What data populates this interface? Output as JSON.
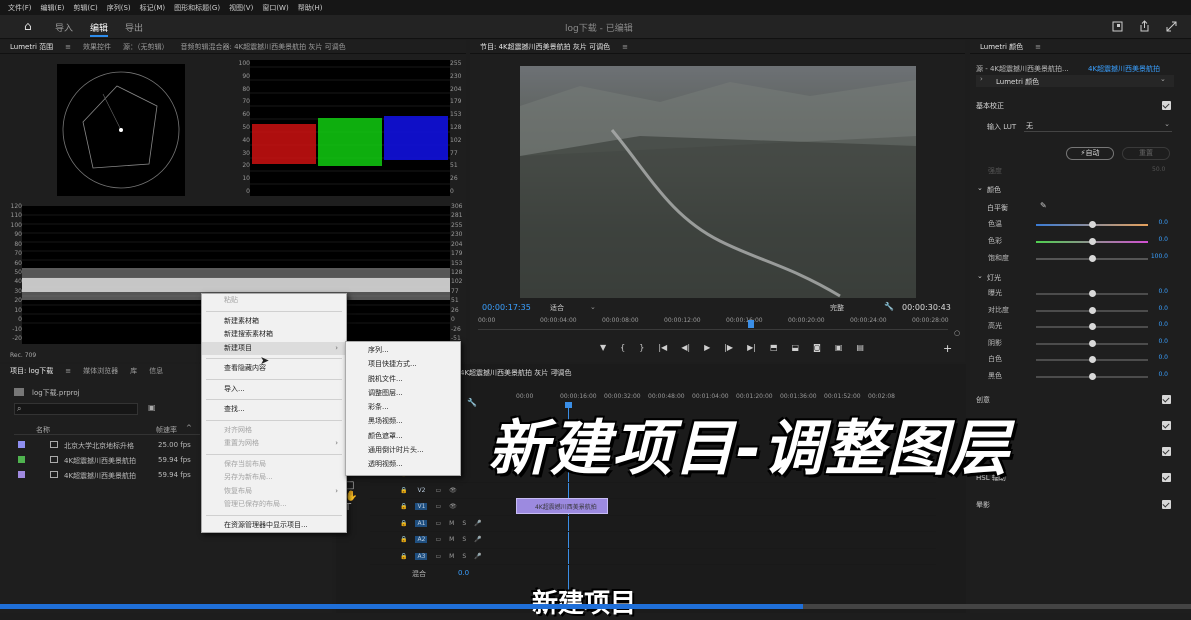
{
  "menubar": [
    "文件(F)",
    "编辑(E)",
    "剪辑(C)",
    "序列(S)",
    "标记(M)",
    "图形和标题(G)",
    "视图(V)",
    "窗口(W)",
    "帮助(H)"
  ],
  "appbar": {
    "home": "⌂",
    "tabs": [
      "导入",
      "编辑",
      "导出"
    ],
    "active": "编辑",
    "title": "log下载 - 已编辑"
  },
  "scopes": {
    "tabs": [
      "Lumetri 范围",
      "效果控件",
      "源：（无剪辑）",
      "音频剪辑混合器: 4K超震撼川西美景航拍 灰片 可调色"
    ],
    "parade_left": [
      "100",
      "90",
      "80",
      "70",
      "60",
      "50",
      "40",
      "30",
      "20",
      "10",
      "0"
    ],
    "parade_right": [
      "255",
      "230",
      "204",
      "179",
      "153",
      "128",
      "102",
      "77",
      "51",
      "26",
      "0"
    ],
    "wave_left": [
      "120",
      "110",
      "100",
      "90",
      "80",
      "70",
      "60",
      "50",
      "40",
      "30",
      "20",
      "10",
      "0",
      "-10",
      "-20"
    ],
    "wave_right": [
      "306",
      "281",
      "255",
      "230",
      "204",
      "179",
      "153",
      "128",
      "102",
      "77",
      "51",
      "26",
      "0",
      "-26",
      "-51"
    ],
    "rec": "Rec. 709"
  },
  "project": {
    "tabs": [
      "项目: log下载",
      "媒体浏览器",
      "库",
      "信息"
    ],
    "file": "log下载.prproj",
    "col_name": "名称",
    "col_rate": "帧速率",
    "items": [
      {
        "name": "北京大学北京地标升格",
        "rate": "25.00 fps",
        "color": "#8e8ef0"
      },
      {
        "name": "4K超震撼川西美景航拍",
        "rate": "59.94 fps",
        "color": "#4fb34f"
      },
      {
        "name": "4K超震撼川西美景航拍",
        "rate": "59.94 fps",
        "color": "#a08ae0"
      }
    ]
  },
  "program": {
    "title": "节目: 4K超震撼川西美景航拍 灰片 可调色",
    "timecode": "00:00:17:35",
    "fit": "适合",
    "full": "完整",
    "duration": "00:00:30:43",
    "ruler": [
      "00:00",
      "00:00:04:00",
      "00:00:08:00",
      "00:00:12:00",
      "00:00:16:00",
      "00:00:20:00",
      "00:00:24:00",
      "00:00:28:00"
    ]
  },
  "timeline": {
    "title": "4K超震撼川西美景航拍 灰片 可调色",
    "ruler": [
      "00:00",
      "00:00:16:00",
      "00:00:32:00",
      "00:00:48:00",
      "00:01:04:00",
      "00:01:20:00",
      "00:01:36:00",
      "00:01:52:00",
      "00:02:08"
    ],
    "tracks": [
      "V3",
      "V2",
      "V1",
      "A1",
      "A2",
      "A3"
    ],
    "clip": "4K超震撼川西美景航拍",
    "mix": "混合",
    "mix_val": "0.0"
  },
  "context_menu": {
    "items": [
      {
        "label": "粘贴",
        "disabled": true
      },
      {
        "sep": true
      },
      {
        "label": "新建素材箱"
      },
      {
        "label": "新建搜索素材箱"
      },
      {
        "label": "新建项目",
        "sub": true,
        "hover": true
      },
      {
        "sep": true
      },
      {
        "label": "查看隐藏内容"
      },
      {
        "sep": true
      },
      {
        "label": "导入..."
      },
      {
        "sep": true
      },
      {
        "label": "查找..."
      },
      {
        "sep": true
      },
      {
        "label": "对齐网格",
        "disabled": true
      },
      {
        "label": "重置为网格",
        "disabled": true,
        "sub": true
      },
      {
        "sep": true
      },
      {
        "label": "保存当前布局",
        "disabled": true
      },
      {
        "label": "另存为新布局...",
        "disabled": true
      },
      {
        "label": "恢复布局",
        "disabled": true,
        "sub": true
      },
      {
        "label": "管理已保存的布局...",
        "disabled": true
      },
      {
        "sep": true
      },
      {
        "label": "在资源管理器中显示项目..."
      }
    ]
  },
  "sub_menu": [
    "序列...",
    "项目快捷方式...",
    "脱机文件...",
    "调整图层...",
    "彩条...",
    "黑场视频...",
    "颜色遮罩...",
    "通用倒计时片头...",
    "透明视频..."
  ],
  "lumetri": {
    "tab": "Lumetri 颜色",
    "source": "源 - 4K超震撼川西美景航拍...",
    "target": "4K超震撼川西美景航拍",
    "effect": "Lumetri 颜色",
    "basic": "基本校正",
    "lut_label": "输入 LUT",
    "lut_val": "无",
    "auto": "自动",
    "reset": "重置",
    "exposure": "强度",
    "exposure_val": "50.0",
    "color": "颜色",
    "wb": "白平衡",
    "sliders": [
      {
        "label": "色温",
        "val": "0.0",
        "g": "linear-gradient(90deg,#3a7bd5,#e6a15c)"
      },
      {
        "label": "色彩",
        "val": "0.0",
        "g": "linear-gradient(90deg,#4fd04f,#d24fd2)"
      },
      {
        "label": "饱和度",
        "val": "100.0",
        "g": "#555"
      }
    ],
    "light": "灯光",
    "light_sliders": [
      {
        "label": "曝光",
        "val": "0.0"
      },
      {
        "label": "对比度",
        "val": "0.0"
      },
      {
        "label": "高光",
        "val": "0.0"
      },
      {
        "label": "阴影",
        "val": "0.0"
      },
      {
        "label": "白色",
        "val": "0.0"
      },
      {
        "label": "黑色",
        "val": "0.0"
      }
    ],
    "sections": [
      "创意",
      "曲线",
      "色轮和匹配",
      "HSL 辅助",
      "晕影"
    ]
  },
  "overlay": {
    "big": "新建项目-调整图层",
    "caption": "新建项目"
  }
}
